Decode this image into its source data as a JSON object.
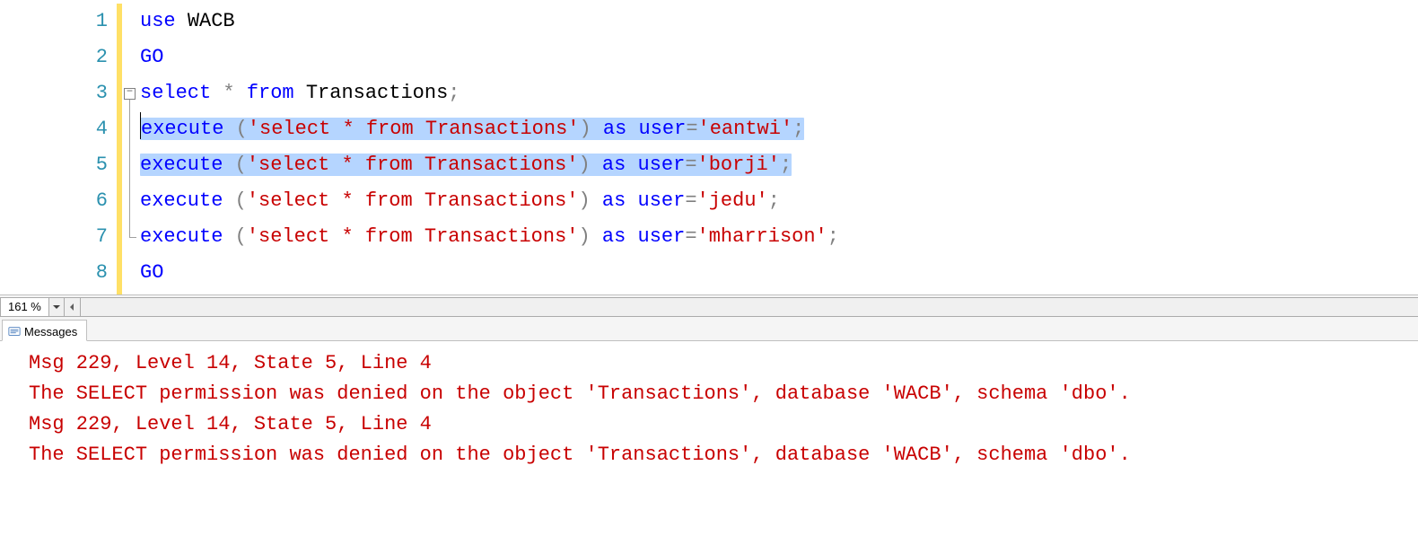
{
  "zoom": {
    "value": "161 %"
  },
  "tabs": {
    "messages": "Messages"
  },
  "code": {
    "lines": [
      {
        "n": "1",
        "indent": "",
        "folding": "",
        "selected": false,
        "tokens": [
          [
            "kw",
            "use"
          ],
          [
            "sp",
            " "
          ],
          [
            "id",
            "WACB"
          ]
        ]
      },
      {
        "n": "2",
        "indent": "",
        "folding": "",
        "selected": false,
        "tokens": [
          [
            "kw",
            "GO"
          ]
        ]
      },
      {
        "n": "3",
        "indent": "",
        "folding": "start",
        "selected": false,
        "tokens": [
          [
            "kw",
            "select"
          ],
          [
            "sp",
            " "
          ],
          [
            "op",
            "*"
          ],
          [
            "sp",
            " "
          ],
          [
            "kw",
            "from"
          ],
          [
            "sp",
            " "
          ],
          [
            "id",
            "Transactions"
          ],
          [
            "op",
            ";"
          ]
        ]
      },
      {
        "n": "4",
        "indent": "",
        "folding": "mid",
        "selected": true,
        "caret": true,
        "tokens": [
          [
            "kw",
            "execute"
          ],
          [
            "sp",
            " "
          ],
          [
            "op",
            "("
          ],
          [
            "str",
            "'select * from Transactions'"
          ],
          [
            "op",
            ")"
          ],
          [
            "sp",
            " "
          ],
          [
            "kw",
            "as"
          ],
          [
            "sp",
            " "
          ],
          [
            "kw",
            "user"
          ],
          [
            "op",
            "="
          ],
          [
            "str",
            "'eantwi'"
          ],
          [
            "op",
            ";"
          ]
        ]
      },
      {
        "n": "5",
        "indent": "",
        "folding": "mid",
        "selected": true,
        "tokens": [
          [
            "kw",
            "execute"
          ],
          [
            "sp",
            " "
          ],
          [
            "op",
            "("
          ],
          [
            "str",
            "'select * from Transactions'"
          ],
          [
            "op",
            ")"
          ],
          [
            "sp",
            " "
          ],
          [
            "kw",
            "as"
          ],
          [
            "sp",
            " "
          ],
          [
            "kw",
            "user"
          ],
          [
            "op",
            "="
          ],
          [
            "str",
            "'borji'"
          ],
          [
            "op",
            ";"
          ]
        ]
      },
      {
        "n": "6",
        "indent": "",
        "folding": "mid",
        "selected": false,
        "tokens": [
          [
            "kw",
            "execute"
          ],
          [
            "sp",
            " "
          ],
          [
            "op",
            "("
          ],
          [
            "str",
            "'select * from Transactions'"
          ],
          [
            "op",
            ")"
          ],
          [
            "sp",
            " "
          ],
          [
            "kw",
            "as"
          ],
          [
            "sp",
            " "
          ],
          [
            "kw",
            "user"
          ],
          [
            "op",
            "="
          ],
          [
            "str",
            "'jedu'"
          ],
          [
            "op",
            ";"
          ]
        ]
      },
      {
        "n": "7",
        "indent": "",
        "folding": "end",
        "selected": false,
        "tokens": [
          [
            "kw",
            "execute"
          ],
          [
            "sp",
            " "
          ],
          [
            "op",
            "("
          ],
          [
            "str",
            "'select * from Transactions'"
          ],
          [
            "op",
            ")"
          ],
          [
            "sp",
            " "
          ],
          [
            "kw",
            "as"
          ],
          [
            "sp",
            " "
          ],
          [
            "kw",
            "user"
          ],
          [
            "op",
            "="
          ],
          [
            "str",
            "'mharrison'"
          ],
          [
            "op",
            ";"
          ]
        ]
      },
      {
        "n": "8",
        "indent": "",
        "folding": "",
        "selected": false,
        "tokens": [
          [
            "kw",
            "GO"
          ]
        ]
      }
    ]
  },
  "messages": {
    "lines": [
      "Msg 229, Level 14, State 5, Line 4",
      "The SELECT permission was denied on the object 'Transactions', database 'WACB', schema 'dbo'.",
      "Msg 229, Level 14, State 5, Line 4",
      "The SELECT permission was denied on the object 'Transactions', database 'WACB', schema 'dbo'."
    ]
  }
}
